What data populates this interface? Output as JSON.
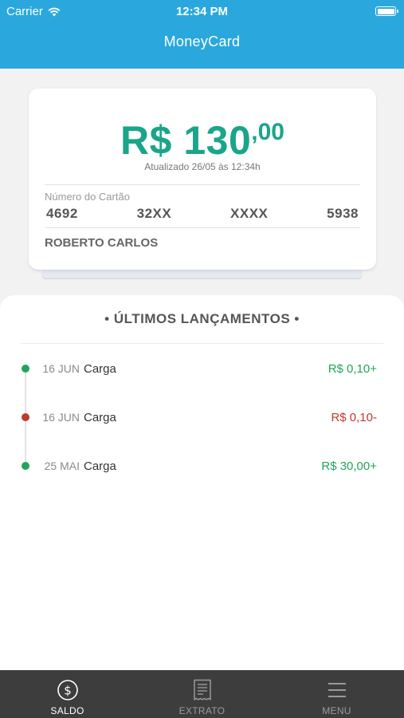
{
  "status_bar": {
    "carrier": "Carrier",
    "time": "12:34 PM"
  },
  "header": {
    "title": "MoneyCard"
  },
  "card": {
    "balance_main": "R$ 130",
    "balance_cents": ",00",
    "updated": "Atualizado 26/05 às 12:34h",
    "number_label": "Número do Cartão",
    "number_groups": [
      "4692",
      "32XX",
      "XXXX",
      "5938"
    ],
    "holder": "ROBERTO CARLOS"
  },
  "transactions": {
    "title": "• ÚLTIMOS LANÇAMENTOS •",
    "items": [
      {
        "date": "16 JUN",
        "description": "Carga",
        "amount": "R$ 0,10+",
        "color": "#21a55b"
      },
      {
        "date": "16 JUN",
        "description": "Carga",
        "amount": "R$ 0,10-",
        "color": "#c0392b"
      },
      {
        "date": "25 MAI",
        "description": "Carga",
        "amount": "R$ 30,00+",
        "color": "#21a55b"
      }
    ]
  },
  "tabbar": {
    "tabs": [
      {
        "label": "SALDO",
        "icon": "dollar-circle-icon",
        "active": true
      },
      {
        "label": "EXTRATO",
        "icon": "receipt-icon",
        "active": false
      },
      {
        "label": "MENU",
        "icon": "hamburger-menu-icon",
        "active": false
      }
    ]
  },
  "colors": {
    "header": "#2aa8de",
    "balance": "#1aa58a",
    "positive": "#21a55b",
    "negative": "#c0392b",
    "tabbar": "#3d3d3d",
    "tab_active": "#ffffff",
    "tab_inactive": "#9a9a9a"
  }
}
